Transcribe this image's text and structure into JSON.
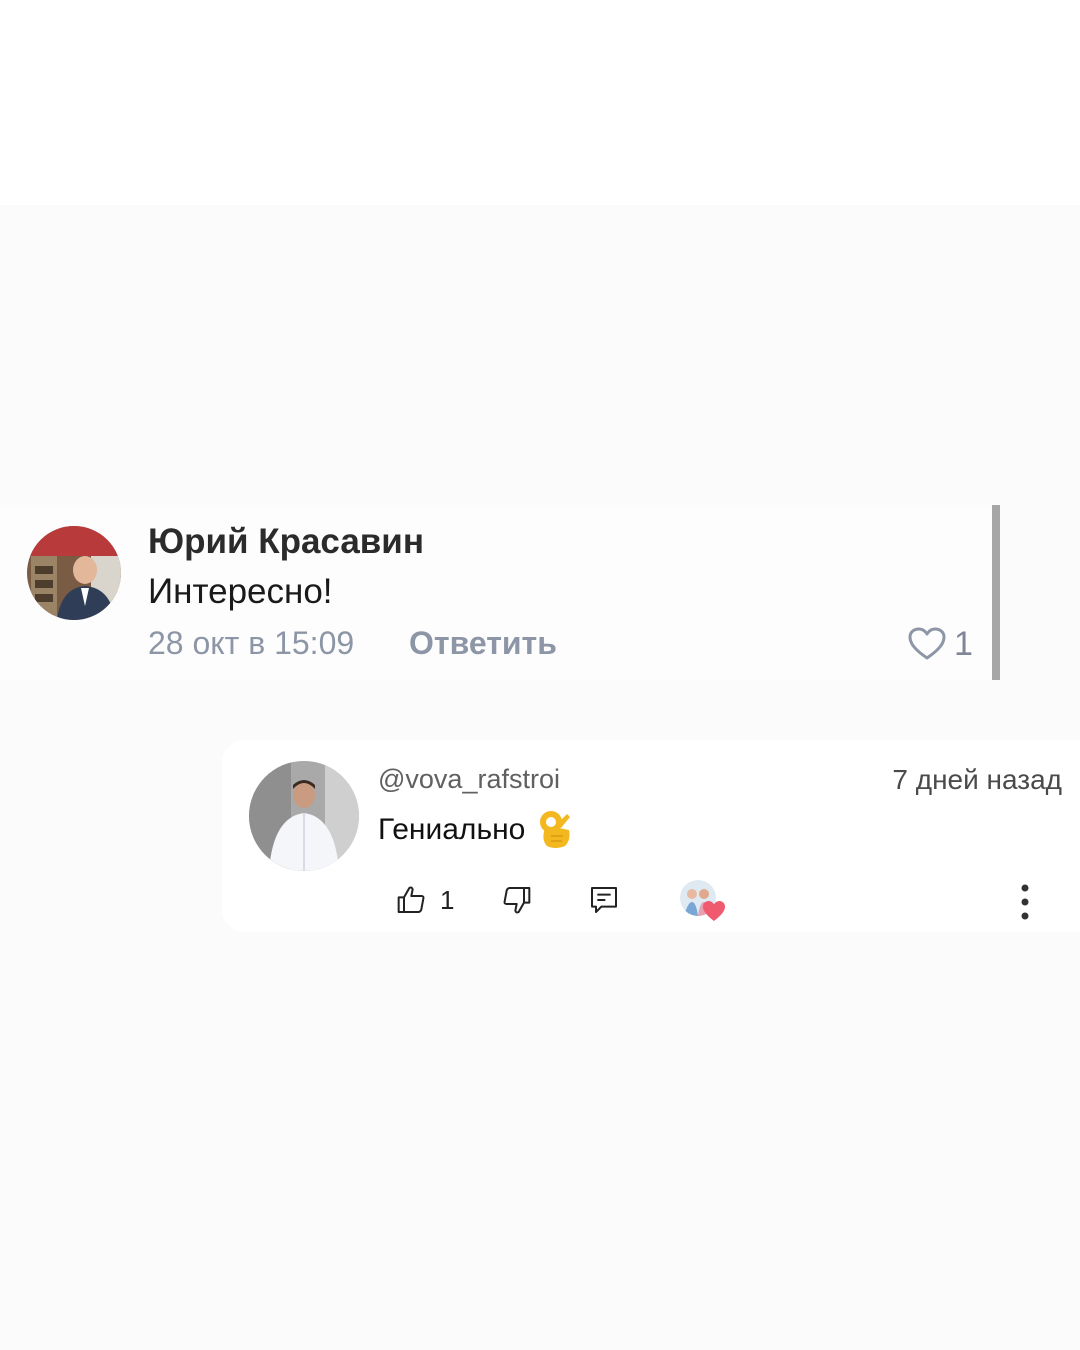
{
  "comment1": {
    "author": "Юрий Красавин",
    "text": "Интересно!",
    "date": "28 окт в 15:09",
    "reply_label": "Ответить",
    "like_count": "1",
    "icons": {
      "like": "heart-outline-icon"
    }
  },
  "comment2": {
    "handle": "@vova_rafstroi",
    "time": "7 дней назад",
    "text": "Гениально",
    "like_count": "1",
    "icons": {
      "emoji": "ok-hand-emoji",
      "like": "thumbs-up-icon",
      "dislike": "thumbs-down-icon",
      "reply": "reply-comment-icon",
      "creator_heart": "creator-heart-badge",
      "menu": "more-vertical-icon"
    }
  },
  "colors": {
    "background": "#fbfbfb",
    "vk_meta": "#8d96a6",
    "heart_badge": "#ef5a6f"
  }
}
